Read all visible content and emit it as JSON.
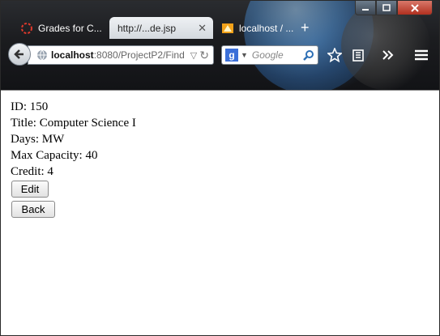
{
  "browser": {
    "tabs": [
      {
        "label": "Grades for C...",
        "icon": "loading-spinner-icon"
      },
      {
        "label": "http://...de.jsp",
        "icon": "none",
        "active": true
      },
      {
        "label": "localhost / ...",
        "icon": "phpmyadmin-icon"
      }
    ],
    "new_tab_label": "+",
    "url_host": "localhost",
    "url_rest": ":8080/ProjectP2/Find",
    "search_placeholder": "Google",
    "colors": {
      "tab_active": "#e4e8ec",
      "chrome_dark": "#1b1c1f",
      "close_button": "#c0392b"
    }
  },
  "page": {
    "fields": [
      {
        "key": "ID:",
        "value": "150"
      },
      {
        "key": "Title:",
        "value": "Computer Science I"
      },
      {
        "key": "Days:",
        "value": "MW"
      },
      {
        "key": "Max Capacity:",
        "value": "40"
      },
      {
        "key": "Credit:",
        "value": "4"
      }
    ],
    "edit_label": "Edit",
    "back_label": "Back"
  }
}
